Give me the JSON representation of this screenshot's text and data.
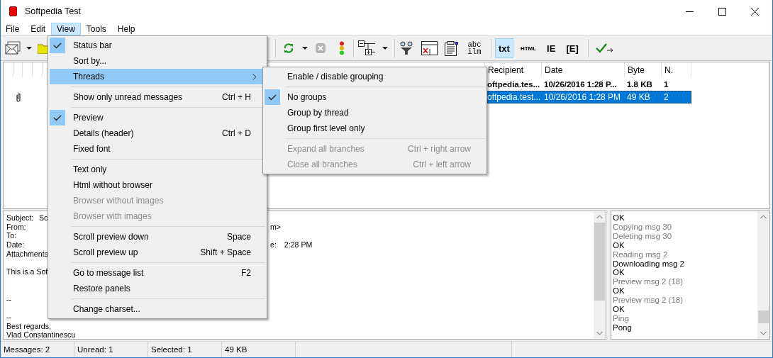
{
  "window": {
    "title": "Softpedia Test"
  },
  "menubar": {
    "items": [
      {
        "label": "File",
        "selected": false
      },
      {
        "label": "Edit",
        "selected": false
      },
      {
        "label": "View",
        "selected": true
      },
      {
        "label": "Tools",
        "selected": false
      },
      {
        "label": "Help",
        "selected": false
      }
    ]
  },
  "toolbar": {
    "text_buttons": [
      {
        "label": "abc ilm",
        "selected": false
      },
      {
        "label": "txt",
        "selected": true
      },
      {
        "label": "HTML",
        "selected": false
      },
      {
        "label": "IE",
        "selected": false
      },
      {
        "label": "[E]",
        "selected": false
      }
    ]
  },
  "message_list": {
    "columns": [
      "Recipient",
      "Date",
      "Byte",
      "N."
    ],
    "rows": [
      {
        "recipient": "oftpedia.tes...",
        "date": "10/26/2016 1:28 P...",
        "byte": "1.8 KB",
        "n": "1",
        "unread": true,
        "selected": false,
        "attachment": false
      },
      {
        "recipient": "oftpedia.test...",
        "date": "10/26/2016 1:28 PM",
        "byte": "49 KB",
        "n": "2",
        "unread": false,
        "selected": true,
        "attachment": true
      }
    ]
  },
  "preview": {
    "header": [
      {
        "label": "Subject:",
        "value": "Sc"
      },
      {
        "label": "From:",
        "tail": "m>"
      },
      {
        "label": "To:"
      },
      {
        "label": "Date:",
        "tail": "e:",
        "tail_value": "2:28 PM"
      },
      {
        "label": "Attachments"
      }
    ],
    "body": [
      [
        "This is a Sof"
      ],
      [
        "--"
      ],
      [
        "--",
        "Best regards,",
        "Vlad Constantinescu"
      ]
    ]
  },
  "log": [
    {
      "text": "OK",
      "muted": false
    },
    {
      "text": "Copying msg 30",
      "muted": true
    },
    {
      "text": "Deleting msg 30",
      "muted": true
    },
    {
      "text": "OK",
      "muted": false
    },
    {
      "text": "Reading msg 2",
      "muted": true
    },
    {
      "text": "Downloading msg 2",
      "muted": false
    },
    {
      "text": "OK",
      "muted": false
    },
    {
      "text": "Preview msg 2 (18)",
      "muted": true
    },
    {
      "text": "OK",
      "muted": false
    },
    {
      "text": "Preview msg 2 (18)",
      "muted": true
    },
    {
      "text": "OK",
      "muted": false
    },
    {
      "text": "Ping",
      "muted": true
    },
    {
      "text": "Pong",
      "muted": false
    }
  ],
  "status_bar": [
    "Messages: 2",
    "Unread: 1",
    "Selected: 1",
    "49 KB"
  ],
  "view_menu": {
    "items": [
      {
        "kind": "item",
        "label": "Status bar",
        "checked": true,
        "disabled": false,
        "selected": false
      },
      {
        "kind": "item",
        "label": "Sort by...",
        "checked": false,
        "disabled": false,
        "selected": false
      },
      {
        "kind": "item",
        "label": "Threads",
        "checked": false,
        "disabled": false,
        "selected": true,
        "submenu": true
      },
      {
        "kind": "separator"
      },
      {
        "kind": "item",
        "label": "Show only unread messages",
        "shortcut": "Ctrl + H",
        "checked": false,
        "disabled": false,
        "selected": false
      },
      {
        "kind": "separator"
      },
      {
        "kind": "item",
        "label": "Preview",
        "checked": true,
        "disabled": false,
        "selected": false
      },
      {
        "kind": "item",
        "label": "Details (header)",
        "shortcut": "Ctrl + D",
        "checked": false,
        "disabled": false,
        "selected": false
      },
      {
        "kind": "item",
        "label": "Fixed font",
        "checked": false,
        "disabled": false,
        "selected": false
      },
      {
        "kind": "separator"
      },
      {
        "kind": "item",
        "label": "Text only",
        "checked": false,
        "disabled": false,
        "selected": false
      },
      {
        "kind": "item",
        "label": "Html without browser",
        "checked": false,
        "disabled": false,
        "selected": false
      },
      {
        "kind": "item",
        "label": "Browser without images",
        "checked": false,
        "disabled": true,
        "selected": false
      },
      {
        "kind": "item",
        "label": "Browser with images",
        "checked": false,
        "disabled": true,
        "selected": false
      },
      {
        "kind": "separator"
      },
      {
        "kind": "item",
        "label": "Scroll preview down",
        "shortcut": "Space",
        "checked": false,
        "disabled": false,
        "selected": false
      },
      {
        "kind": "item",
        "label": "Scroll preview up",
        "shortcut": "Shift + Space",
        "checked": false,
        "disabled": false,
        "selected": false
      },
      {
        "kind": "separator"
      },
      {
        "kind": "item",
        "label": "Go to message list",
        "shortcut": "F2",
        "checked": false,
        "disabled": false,
        "selected": false
      },
      {
        "kind": "item",
        "label": "Restore panels",
        "checked": false,
        "disabled": false,
        "selected": false
      },
      {
        "kind": "separator"
      },
      {
        "kind": "item",
        "label": "Change charset...",
        "checked": false,
        "disabled": false,
        "selected": false
      }
    ]
  },
  "threads_menu": {
    "items": [
      {
        "kind": "item",
        "label": "Enable / disable grouping",
        "checked": false,
        "disabled": false,
        "selected": false
      },
      {
        "kind": "separator"
      },
      {
        "kind": "item",
        "label": "No groups",
        "checked": true,
        "disabled": false,
        "selected": false
      },
      {
        "kind": "item",
        "label": "Group by thread",
        "checked": false,
        "disabled": false,
        "selected": false
      },
      {
        "kind": "item",
        "label": "Group first level only",
        "checked": false,
        "disabled": false,
        "selected": false
      },
      {
        "kind": "separator"
      },
      {
        "kind": "item",
        "label": "Expand all branches",
        "shortcut": "Ctrl + right arrow",
        "checked": false,
        "disabled": true,
        "selected": false
      },
      {
        "kind": "item",
        "label": "Close all branches",
        "shortcut": "Ctrl + left arrow",
        "checked": false,
        "disabled": true,
        "selected": false
      }
    ]
  }
}
